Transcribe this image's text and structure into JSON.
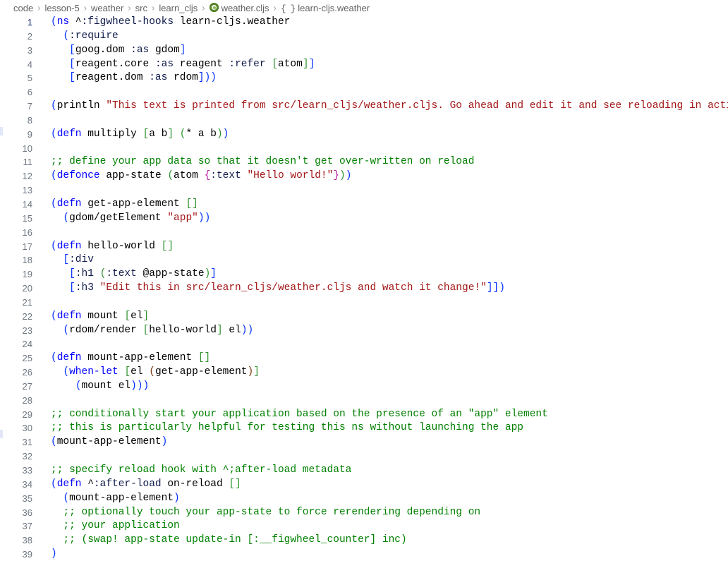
{
  "breadcrumb": {
    "items": [
      {
        "label": "code",
        "icon": null
      },
      {
        "label": "lesson-5",
        "icon": null
      },
      {
        "label": "weather",
        "icon": null
      },
      {
        "label": "src",
        "icon": null
      },
      {
        "label": "learn_cljs",
        "icon": null
      },
      {
        "label": "weather.cljs",
        "icon": "clojurescript-file-icon"
      },
      {
        "label": "learn-cljs.weather",
        "icon": "braces-symbol-icon"
      }
    ],
    "separator": "›"
  },
  "editor": {
    "language": "clojure",
    "file_name": "weather.cljs",
    "namespace": "learn-cljs.weather",
    "first_line_number": 1,
    "last_line_number": 39,
    "current_line": 1,
    "colors": {
      "background": "#ffffff",
      "foreground": "#000000",
      "line_number": "#6e7681",
      "line_number_active": "#0b216f",
      "keyword": "#0000ff",
      "string": "#a31515",
      "comment": "#008000",
      "paren_depth_0": "#0431fa",
      "paren_depth_1": "#319331",
      "paren_depth_2": "#7b3814",
      "paren_depth_3": "#b5179e",
      "bracket_red": "#c21b1b"
    },
    "lines": [
      {
        "n": 1,
        "text": "(ns ^:figwheel-hooks learn-cljs.weather"
      },
      {
        "n": 2,
        "text": "  (:require"
      },
      {
        "n": 3,
        "text": "   [goog.dom :as gdom]"
      },
      {
        "n": 4,
        "text": "   [reagent.core :as reagent :refer [atom]]"
      },
      {
        "n": 5,
        "text": "   [reagent.dom :as rdom]))"
      },
      {
        "n": 6,
        "text": ""
      },
      {
        "n": 7,
        "text": "(println \"This text is printed from src/learn_cljs/weather.cljs. Go ahead and edit it and see reloading in action.\")"
      },
      {
        "n": 8,
        "text": ""
      },
      {
        "n": 9,
        "text": "(defn multiply [a b] (* a b))"
      },
      {
        "n": 10,
        "text": ""
      },
      {
        "n": 11,
        "text": ";; define your app data so that it doesn't get over-written on reload"
      },
      {
        "n": 12,
        "text": "(defonce app-state (atom {:text \"Hello world!\"}))"
      },
      {
        "n": 13,
        "text": ""
      },
      {
        "n": 14,
        "text": "(defn get-app-element []"
      },
      {
        "n": 15,
        "text": "  (gdom/getElement \"app\"))"
      },
      {
        "n": 16,
        "text": ""
      },
      {
        "n": 17,
        "text": "(defn hello-world []"
      },
      {
        "n": 18,
        "text": "  [:div"
      },
      {
        "n": 19,
        "text": "   [:h1 (:text @app-state)]"
      },
      {
        "n": 20,
        "text": "   [:h3 \"Edit this in src/learn_cljs/weather.cljs and watch it change!\"]])"
      },
      {
        "n": 21,
        "text": ""
      },
      {
        "n": 22,
        "text": "(defn mount [el]"
      },
      {
        "n": 23,
        "text": "  (rdom/render [hello-world] el))"
      },
      {
        "n": 24,
        "text": ""
      },
      {
        "n": 25,
        "text": "(defn mount-app-element []"
      },
      {
        "n": 26,
        "text": "  (when-let [el (get-app-element)]"
      },
      {
        "n": 27,
        "text": "    (mount el)))"
      },
      {
        "n": 28,
        "text": ""
      },
      {
        "n": 29,
        "text": ";; conditionally start your application based on the presence of an \"app\" element"
      },
      {
        "n": 30,
        "text": ";; this is particularly helpful for testing this ns without launching the app"
      },
      {
        "n": 31,
        "text": "(mount-app-element)"
      },
      {
        "n": 32,
        "text": ""
      },
      {
        "n": 33,
        "text": ";; specify reload hook with ^;after-load metadata"
      },
      {
        "n": 34,
        "text": "(defn ^:after-load on-reload []"
      },
      {
        "n": 35,
        "text": "  (mount-app-element)"
      },
      {
        "n": 36,
        "text": "  ;; optionally touch your app-state to force rerendering depending on"
      },
      {
        "n": 37,
        "text": "  ;; your application"
      },
      {
        "n": 38,
        "text": "  ;; (swap! app-state update-in [:__figwheel_counter] inc)"
      },
      {
        "n": 39,
        "text": ")"
      }
    ],
    "overview_marks": [
      {
        "top_pct": 20.5
      },
      {
        "top_pct": 76.0
      }
    ]
  }
}
